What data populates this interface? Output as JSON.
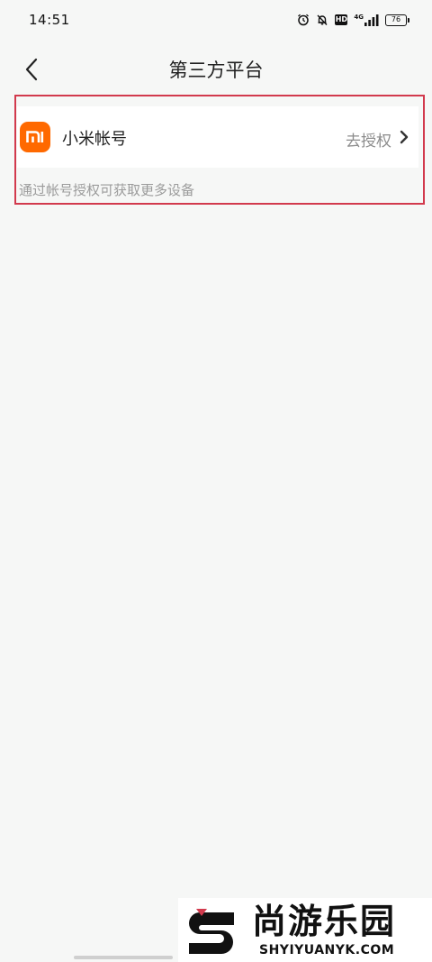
{
  "status_bar": {
    "time": "14:51",
    "network": "4G",
    "hd": "HD",
    "battery": "76",
    "icons": [
      "alarm-icon",
      "mute-bell-icon",
      "hd-icon",
      "signal-icon",
      "battery-icon"
    ]
  },
  "header": {
    "title": "第三方平台",
    "back_icon": "chevron-left-icon"
  },
  "account_section": {
    "highlight_color": "#d23a4d",
    "row": {
      "logo_text": "MI",
      "logo_color": "#ff6900",
      "label": "小米帐号",
      "action": "去授权",
      "action_icon": "chevron-right-icon"
    },
    "hint": "通过帐号授权可获取更多设备"
  },
  "watermark": {
    "chinese": "尚游乐园",
    "english": "SHYIYUANYK.COM"
  }
}
